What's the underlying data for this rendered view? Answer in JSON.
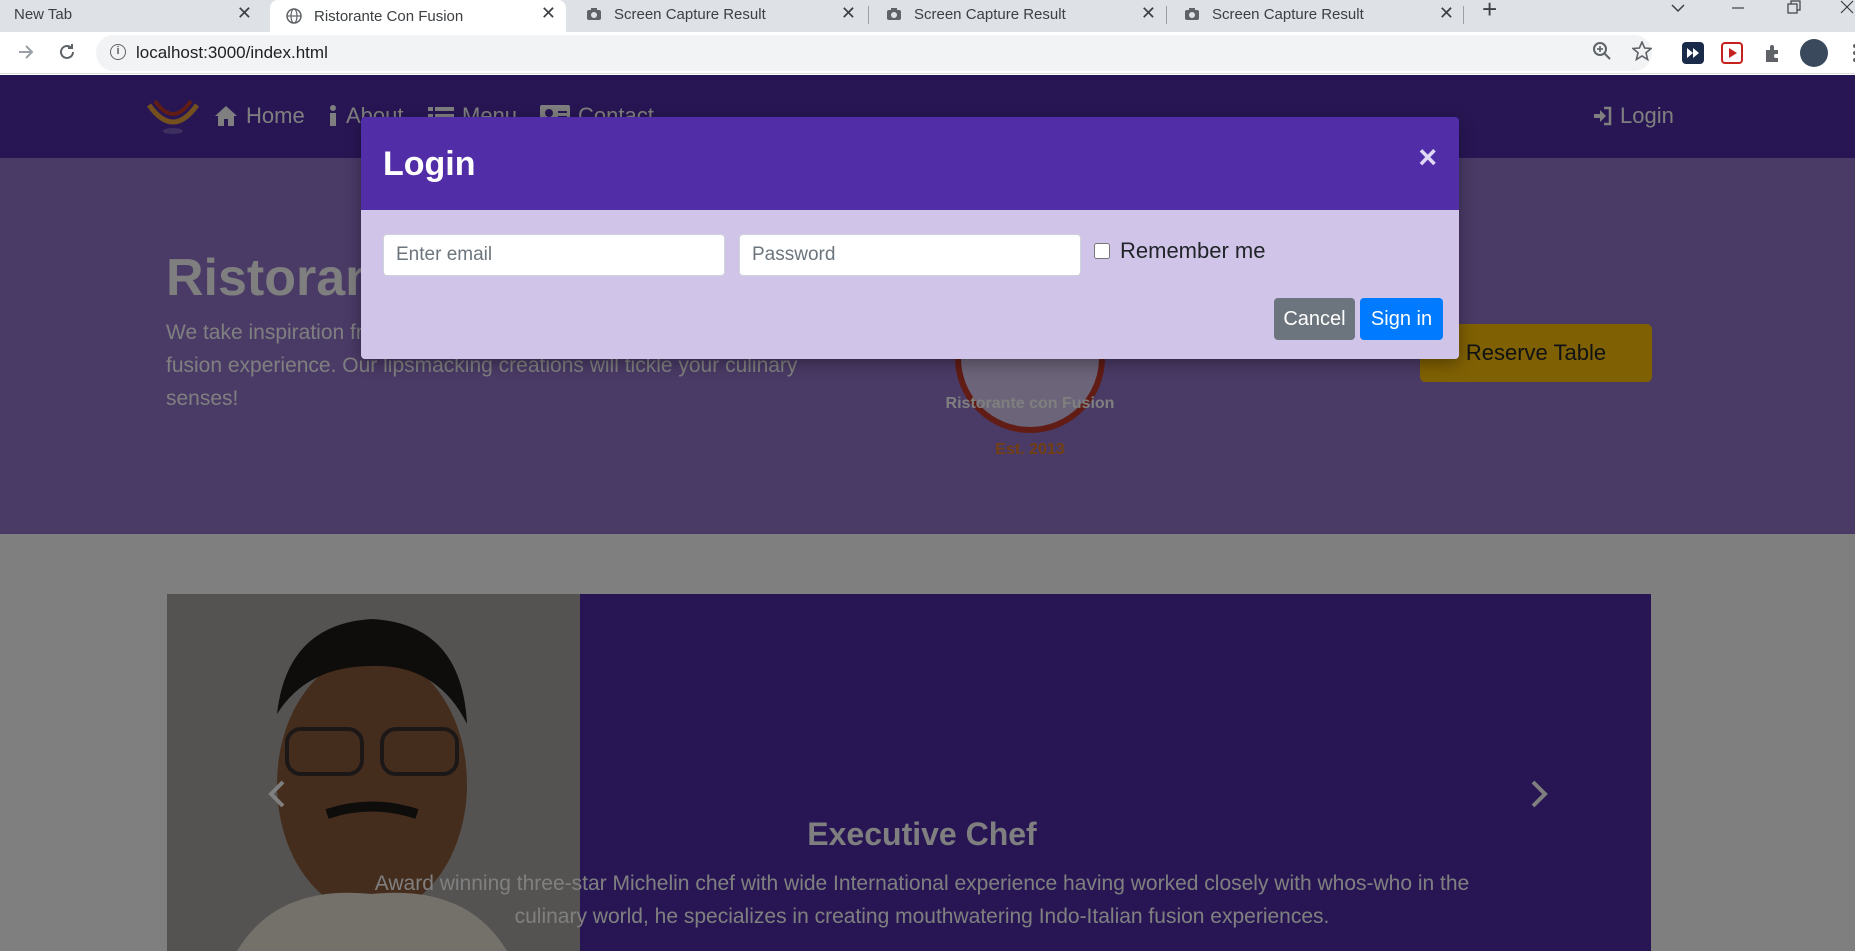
{
  "browser": {
    "tabs": [
      {
        "title": "New Tab",
        "active": false
      },
      {
        "title": "Ristorante Con Fusion",
        "active": true
      },
      {
        "title": "Screen Capture Result",
        "active": false
      },
      {
        "title": "Screen Capture Result",
        "active": false
      },
      {
        "title": "Screen Capture Result",
        "active": false
      }
    ],
    "close_glyph": "✕",
    "new_tab_glyph": "+",
    "url": "localhost:3000/index.html"
  },
  "navbar": {
    "items": [
      {
        "label": "Home",
        "icon": "home-icon"
      },
      {
        "label": "About",
        "icon": "info-icon"
      },
      {
        "label": "Menu",
        "icon": "list-icon"
      },
      {
        "label": "Contact",
        "icon": "address-card-icon"
      }
    ],
    "login_label": "Login",
    "colors": {
      "primary": "#512da8",
      "jumbotron": "#9575cd",
      "modal_body": "#d1c4e9"
    }
  },
  "jumbotron": {
    "title": "Ristorante con Fusion",
    "text": "We take inspiration from the World's best cuisines, and create a unique fusion experience. Our lipsmacking creations will tickle your culinary senses!",
    "reserve_label": "Reserve Table",
    "logo_text": "Ristorante con Fusion",
    "logo_est": "Est. 2013"
  },
  "carousel": {
    "heading": "Executive Chef",
    "text": "Award winning three-star Michelin chef with wide International experience having worked closely with whos-who in the culinary world, he specializes in creating mouthwatering Indo-Italian fusion experiences."
  },
  "modal": {
    "title": "Login",
    "close_glyph": "×",
    "email_placeholder": "Enter email",
    "password_placeholder": "Password",
    "remember_label": "Remember me",
    "cancel_label": "Cancel",
    "signin_label": "Sign in"
  }
}
